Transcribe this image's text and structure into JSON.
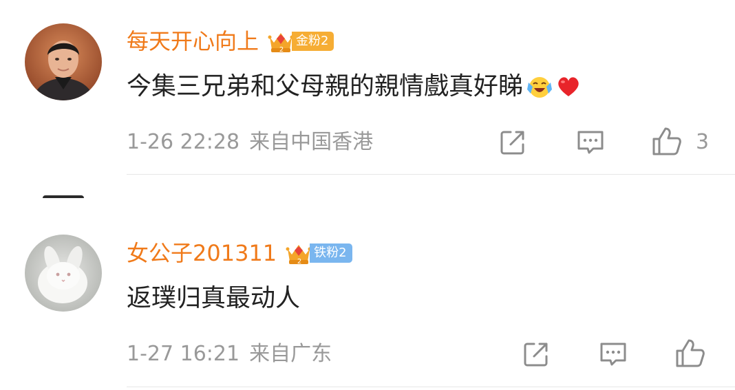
{
  "comments": [
    {
      "username": "每天开心向上",
      "fan_badge": {
        "label": "金粉2",
        "tier": "gold",
        "color": "#f6ad34"
      },
      "text": "今集三兄弟和父母親的親情戲真好睇",
      "emojis": [
        "laughing-tears-emoji",
        "red-heart-emoji"
      ],
      "time": "1-26 22:28",
      "location": "来自中国香港",
      "likes": "3"
    },
    {
      "username": "女公子201311",
      "fan_badge": {
        "label": "铁粉2",
        "tier": "iron",
        "color": "#7ab6ef"
      },
      "text": "返璞归真最动人",
      "emojis": [],
      "time": "1-27 16:21",
      "location": "来自广东",
      "likes": ""
    }
  ],
  "icons": {
    "share": "share-icon",
    "reply": "comment-icon",
    "like": "thumbs-up-icon"
  },
  "colors": {
    "username": "#f07a1a",
    "meta": "#999999",
    "text": "#222222"
  }
}
